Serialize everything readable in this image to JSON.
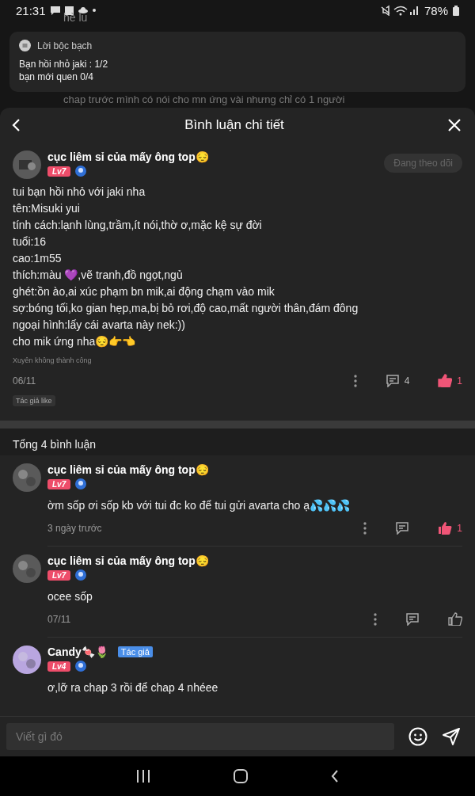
{
  "status_bar": {
    "time": "21:31",
    "battery": "78%"
  },
  "background": {
    "texts": [
      "hè lu",
      "chap trước mình có nói cho mn ứng vài nhưng chỉ có 1 người"
    ]
  },
  "notification": {
    "app": "Lời bộc bạch",
    "lines": [
      "Bạn hồi nhỏ jaki : 1/2",
      "bạn mới quen 0/4"
    ]
  },
  "modal": {
    "title": "Bình luận chi tiết"
  },
  "post": {
    "author": "cục liêm sỉ của mấy ông top😔",
    "level": "Lv7",
    "follow_button": "Đang theo dõi",
    "following": true,
    "lines": [
      "tui bạn hồi nhỏ với jaki nha",
      "tên:Misuki yui",
      "tính cách:lạnh lùng,trầm,ít nói,thờ ơ,mặc kệ sự đời",
      "tuổi:16",
      "cao:1m55",
      "thích:màu 💜,vẽ tranh,đồ ngọt,ngủ",
      "ghét:ồn ào,ai xúc phạm bn mik,ai động chạm vào mik",
      "sợ:bóng tối,ko gian hẹp,ma,bị bỏ rơi,độ cao,mất người thân,đám đông",
      "ngoại hình:lấy cái avarta này nek:))",
      "cho mik ứng nha😔👉👈"
    ],
    "caption": "Xuyên không thành công",
    "date": "06/11",
    "reply_count": "4",
    "like_count": "1",
    "liked": true,
    "tag": "Tác giả like"
  },
  "comments_header": "Tổng 4 bình luận",
  "comments": [
    {
      "author": "cục liêm sỉ của mấy ông top😔",
      "color": "#5a5a5a",
      "level": "Lv7",
      "text": "ờm sốp ơi sốp kb với tui đc ko để tui gửi avarta cho ạ💦💦💦",
      "time": "3 ngày trước",
      "like_count": "1",
      "liked": true
    },
    {
      "author": "cục liêm sỉ của mấy ông top😔",
      "color": "#5a5a5a",
      "level": "Lv7",
      "text": "ocee sốp",
      "time": "07/11",
      "liked": false
    },
    {
      "author": "Candy🍬🌷",
      "color": "#b9a6e0",
      "level": "Lv4",
      "badge": "Tác giả",
      "text": "ơ,lỡ ra chap 3 rồi để chap 4 nhéee"
    }
  ],
  "input": {
    "placeholder": "Viết gì đó"
  }
}
